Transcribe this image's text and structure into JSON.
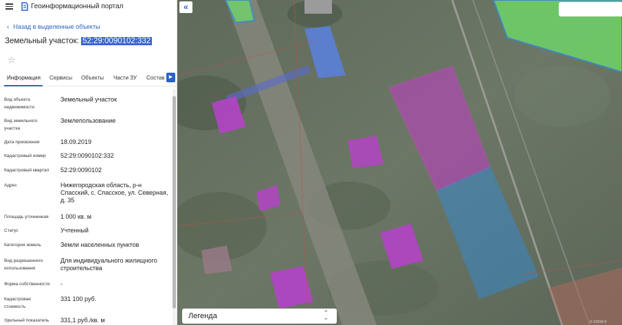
{
  "app": {
    "title": "Геоинформационный портал"
  },
  "nav": {
    "back_label": "Назад в выделенные объекты"
  },
  "parcel": {
    "title_prefix": "Земельный участок:",
    "number": "52:29:0090102:332"
  },
  "tabs": [
    {
      "label": "Информация"
    },
    {
      "label": "Сервисы"
    },
    {
      "label": "Объекты"
    },
    {
      "label": "Части ЗУ"
    },
    {
      "label": "Состав"
    }
  ],
  "attributes": [
    {
      "label": "Вид объекта недвижимости",
      "value": "Земельный участок"
    },
    {
      "label": "Вид земельного участка",
      "value": "Землепользование"
    },
    {
      "label": "Дата присвоения",
      "value": "18.09.2019"
    },
    {
      "label": "Кадастровый номер",
      "value": "52:29:0090102:332"
    },
    {
      "label": "Кадастровый квартал",
      "value": "52:29:0090102"
    },
    {
      "label": "Адрес",
      "value": "Нижегородская область, р-н Спасский, с. Спасское, ул. Северная, д. 35"
    },
    {
      "label": "Площадь уточненная",
      "value": "1 000 кв. м"
    },
    {
      "label": "Статус",
      "value": "Учтенный"
    },
    {
      "label": "Категория земель",
      "value": "Земли населенных пунктов"
    },
    {
      "label": "Вид разрешенного использования",
      "value": "Для индивидуального жилищного строительства"
    },
    {
      "label": "Форма собственности",
      "value": "-"
    },
    {
      "label": "Кадастровая стоимость",
      "value": "331 100 руб."
    },
    {
      "label": "Удельный показатель",
      "value": "331,1 руб./кв. м"
    }
  ],
  "map": {
    "legend_label": "Легенда",
    "copyright": "© ©2024 ©"
  },
  "colors": {
    "accent": "#2a63c4",
    "selection_highlight": "#3a63d8",
    "parcel_magenta": "#c33bc8",
    "parcel_blue": "#2f8fe0",
    "parcel_green": "#6fe06a"
  },
  "icons": [
    "menu-icon",
    "portal-logo-icon",
    "chevron-left-icon",
    "star-icon",
    "chevron-right-icon",
    "double-chevron-left-icon",
    "chevron-up-down-icon"
  ]
}
